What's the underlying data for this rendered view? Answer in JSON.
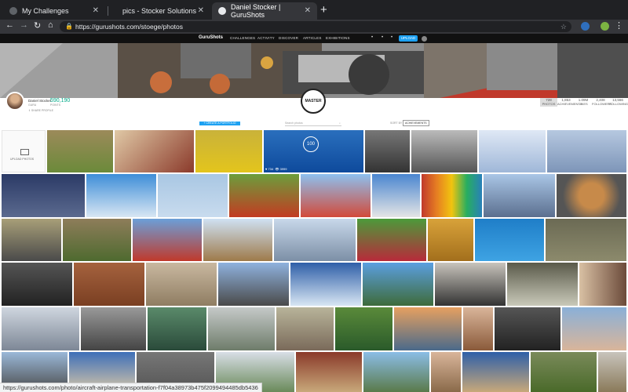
{
  "browser": {
    "tabs": [
      {
        "title": "My Challenges",
        "active": false
      },
      {
        "title": "pics - Stocker Solutions",
        "active": false
      },
      {
        "title": "Daniel Stocker | GuruShots",
        "active": true
      }
    ],
    "new_tab_icon": "plus-icon",
    "url": "https://gurushots.com/stoege/photos",
    "status_url": "https://gurushots.com/photo/aircraft-airplane-transportation-f7f04a38973b475f2099494485db5436"
  },
  "site": {
    "logo": "GuruShots",
    "nav": [
      "CHALLENGES",
      "ACTIVITY",
      "DISCOVER",
      "ARTICLES",
      "EXHIBITIONS"
    ],
    "upload_label": "UPLOAD"
  },
  "profile": {
    "name": "Daniel Stocker",
    "level": "GURU",
    "points": "590,190",
    "points_label": "POINTS",
    "share_label": "SHARE PROFILE",
    "badge": "MASTER",
    "stats": [
      {
        "num": "728",
        "label": "PHOTOS"
      },
      {
        "num": "1,853",
        "label": "ACHIEVEMENTS"
      },
      {
        "num": "1.09M",
        "label": "LIKES"
      },
      {
        "num": "2,408",
        "label": "FOLLOWERS"
      },
      {
        "num": "13,566",
        "label": "FOLLOWING"
      }
    ]
  },
  "controls": {
    "create_label": "+ CREATE A PORTFOLIO WEBSITE",
    "search_placeholder": "Search photos",
    "sort_label": "SORT BY",
    "sort_value": "ACHIEVEMENTS"
  },
  "upload_tile_label": "UPLOAD PHOTOS",
  "hover_card": {
    "badge": "100",
    "likes": "734",
    "views": "3999"
  },
  "colors": {
    "accent": "#1da1f2",
    "dark_bar": "#111111",
    "chrome": "#35363a"
  }
}
